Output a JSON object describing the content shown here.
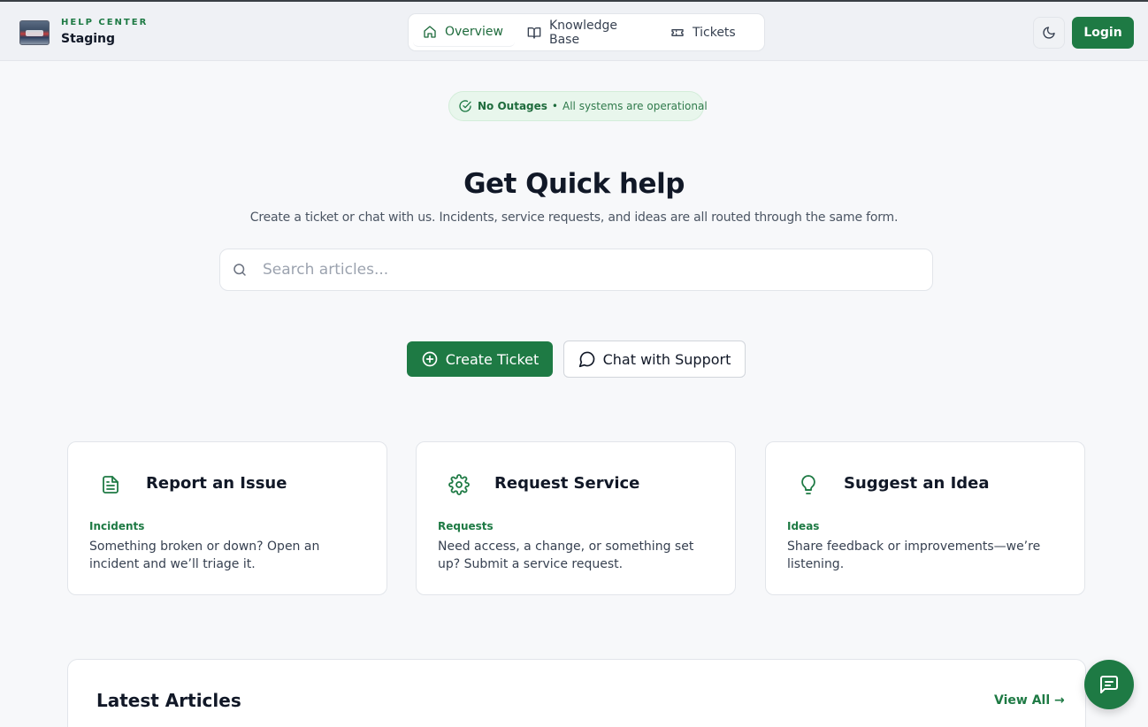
{
  "header": {
    "brand_kicker": "HELP CENTER",
    "brand_name": "Staging",
    "logo_icon": "portal-logo-image",
    "nav": [
      {
        "label": "Overview",
        "icon": "home-icon",
        "active": true
      },
      {
        "label": "Knowledge Base",
        "icon": "book-open-icon",
        "active": false
      },
      {
        "label": "Tickets",
        "icon": "ticket-icon",
        "active": false
      }
    ],
    "theme_toggle_icon": "moon-icon",
    "login_label": "Login"
  },
  "status": {
    "strong": "No Outages",
    "separator": "•",
    "description": "All systems are operational",
    "icon": "check-circle-icon"
  },
  "hero": {
    "title": "Get Quick help",
    "subtitle": "Create a ticket or chat with us. Incidents, service requests, and ideas are all routed through the same form."
  },
  "search": {
    "placeholder": "Search articles...",
    "value": ""
  },
  "actions": {
    "create_ticket": "Create Ticket",
    "chat_support": "Chat with Support"
  },
  "cards": [
    {
      "title": "Report an Issue",
      "tag": "Incidents",
      "description": "Something broken or down? Open an incident and we’ll triage it.",
      "icon": "document-icon"
    },
    {
      "title": "Request Service",
      "tag": "Requests",
      "description": "Need access, a change, or something set up? Submit a service request.",
      "icon": "gear-icon"
    },
    {
      "title": "Suggest an Idea",
      "tag": "Ideas",
      "description": "Share feedback or improvements—we’re listening.",
      "icon": "lightbulb-icon"
    }
  ],
  "articles": {
    "title": "Latest Articles",
    "view_all": "View All →"
  },
  "colors": {
    "brand": "#1e7a44",
    "status_bg": "#e8f6ec",
    "page_bg": "#f7f8fa"
  }
}
